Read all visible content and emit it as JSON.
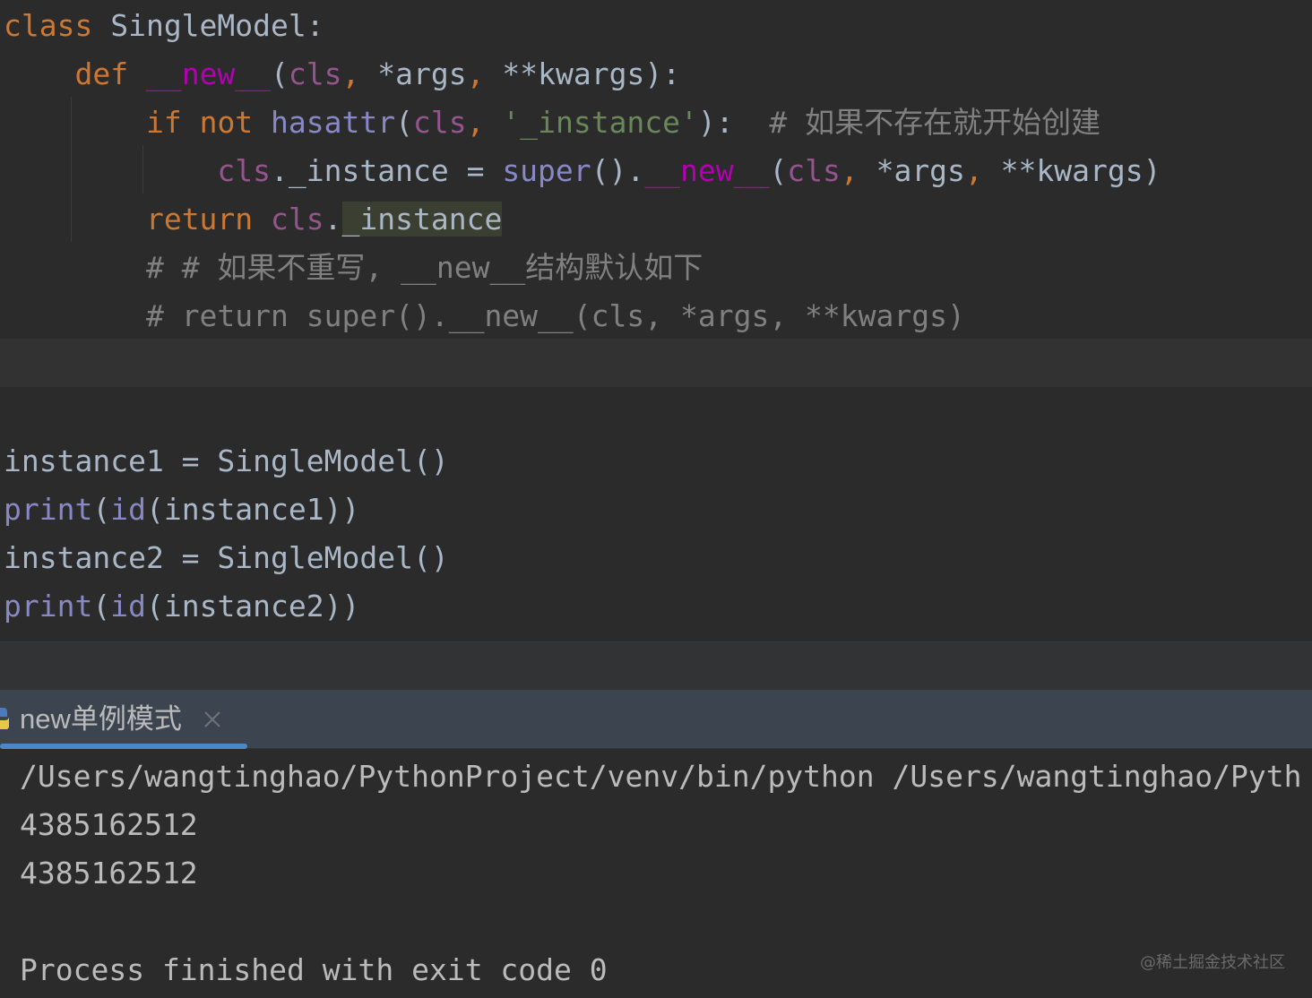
{
  "editor": {
    "line1": {
      "kw": "class",
      "name": " SingleModel:"
    },
    "line2": {
      "kw": "def",
      "sp": " ",
      "magic": "__new__",
      "open": "(",
      "cls": "cls",
      "rest1": ", ",
      "args": "*args",
      "comma2": ", ",
      "kwargs": "**kwargs",
      "close": "):"
    },
    "line3": {
      "kw_if": "if",
      "kw_not": " not ",
      "hasattr": "hasattr",
      "open": "(",
      "cls": "cls",
      "comma": ", ",
      "str": "'_instance'",
      "close": "):  ",
      "comment": "# 如果不存在就开始创建"
    },
    "line4": {
      "cls": "cls",
      "attr": "._instance = ",
      "super": "super",
      "paren": "().",
      "magic": "__new__",
      "open": "(",
      "cls2": "cls",
      "comma": ", ",
      "args": "*args",
      "comma2": ", ",
      "kwargs": "**kwargs)"
    },
    "line5": {
      "kw": "return",
      "sp": " ",
      "cls": "cls",
      "dot": ".",
      "attr": "_instance"
    },
    "line6": {
      "comment": "# # 如果不重写, __new__结构默认如下"
    },
    "line7": {
      "comment": "# return super().__new__(cls, *args, **kwargs)"
    },
    "line8": {
      "var": "instance1 = SingleModel()"
    },
    "line9": {
      "print": "print",
      "open": "(",
      "id": "id",
      "rest": "(instance1))"
    },
    "line10": {
      "var": "instance2 = SingleModel()"
    },
    "line11": {
      "print": "print",
      "open": "(",
      "id": "id",
      "rest": "(instance2))"
    }
  },
  "run_panel": {
    "tab_label": "new单例模式",
    "output": [
      "/Users/wangtinghao/PythonProject/venv/bin/python /Users/wangtinghao/Pyth",
      "4385162512",
      "4385162512",
      "",
      "Process finished with exit code 0"
    ]
  },
  "watermark": "@稀土掘金技术社区",
  "colors": {
    "background": "#2b2b2b",
    "keyword": "#cc7832",
    "magic": "#b200b2",
    "self": "#94558d",
    "builtin": "#8888c6",
    "string": "#6a8759",
    "comment": "#808080",
    "tab_accent": "#4a88c7"
  },
  "icons": {
    "tab_icon": "python-icon",
    "tab_close": "close-icon"
  }
}
